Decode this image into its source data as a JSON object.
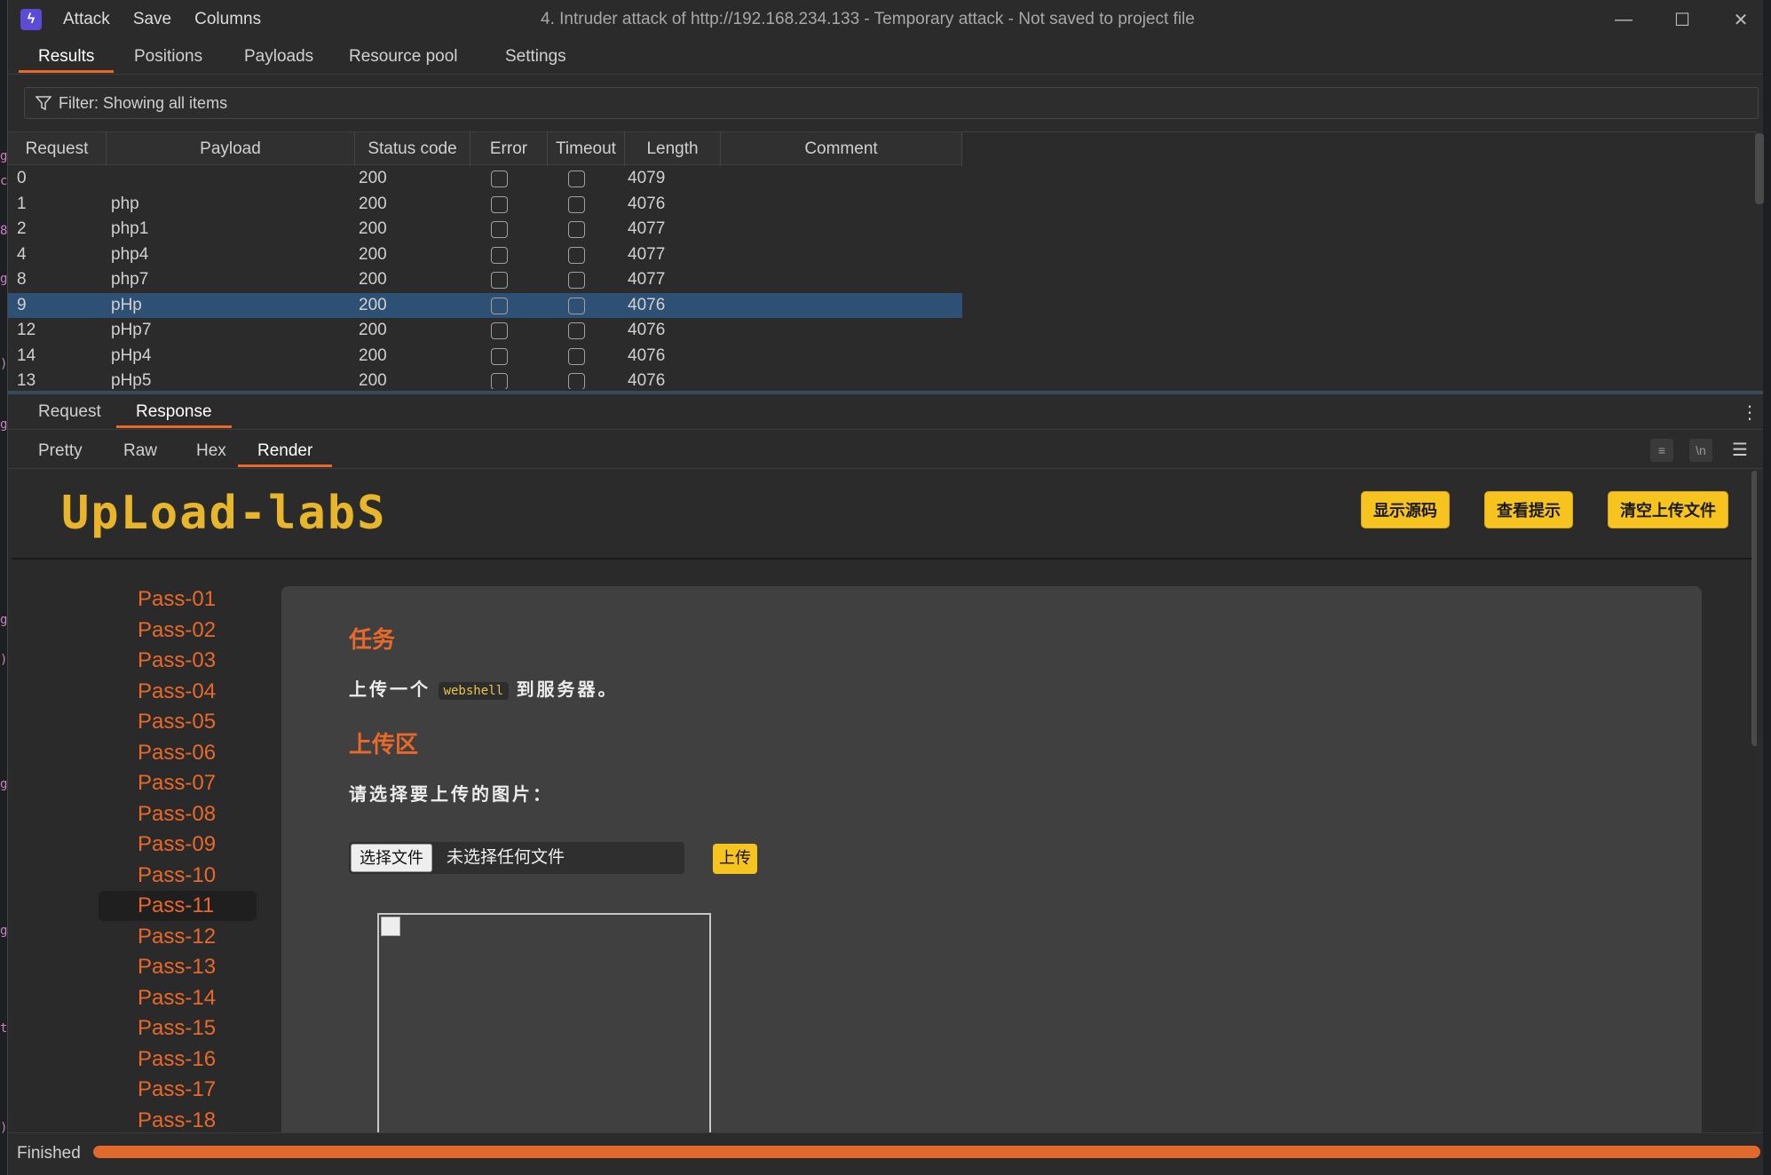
{
  "app": {
    "menu": [
      "Attack",
      "Save",
      "Columns"
    ],
    "title": "4. Intruder attack of http://192.168.234.133 - Temporary attack - Not saved to project file"
  },
  "tabs": [
    "Results",
    "Positions",
    "Payloads",
    "Resource pool",
    "Settings"
  ],
  "filter": {
    "text": "Filter: Showing all items"
  },
  "results": {
    "columns": [
      "Request",
      "Payload",
      "Status code",
      "Error",
      "Timeout",
      "Length",
      "Comment"
    ],
    "rows": [
      {
        "request": "0",
        "payload": "",
        "status": "200",
        "error": false,
        "timeout": false,
        "length": "4079"
      },
      {
        "request": "1",
        "payload": "php",
        "status": "200",
        "error": false,
        "timeout": false,
        "length": "4076"
      },
      {
        "request": "2",
        "payload": "php1",
        "status": "200",
        "error": false,
        "timeout": false,
        "length": "4077"
      },
      {
        "request": "4",
        "payload": "php4",
        "status": "200",
        "error": false,
        "timeout": false,
        "length": "4077"
      },
      {
        "request": "8",
        "payload": "php7",
        "status": "200",
        "error": false,
        "timeout": false,
        "length": "4077"
      },
      {
        "request": "9",
        "payload": "pHp",
        "status": "200",
        "error": false,
        "timeout": false,
        "length": "4076",
        "selected": true
      },
      {
        "request": "12",
        "payload": "pHp7",
        "status": "200",
        "error": false,
        "timeout": false,
        "length": "4076"
      },
      {
        "request": "14",
        "payload": "pHp4",
        "status": "200",
        "error": false,
        "timeout": false,
        "length": "4076"
      },
      {
        "request": "13",
        "payload": "pHp5",
        "status": "200",
        "error": false,
        "timeout": false,
        "length": "4076"
      }
    ]
  },
  "message_tabs": [
    "Request",
    "Response"
  ],
  "view_tabs": [
    "Pretty",
    "Raw",
    "Hex",
    "Render"
  ],
  "render": {
    "logo": "UpLoad-labS",
    "header_buttons": [
      "显示源码",
      "查看提示",
      "清空上传文件"
    ],
    "passes": [
      "Pass-01",
      "Pass-02",
      "Pass-03",
      "Pass-04",
      "Pass-05",
      "Pass-06",
      "Pass-07",
      "Pass-08",
      "Pass-09",
      "Pass-10",
      "Pass-11",
      "Pass-12",
      "Pass-13",
      "Pass-14",
      "Pass-15",
      "Pass-16",
      "Pass-17",
      "Pass-18"
    ],
    "current_pass": "Pass-11",
    "task_heading": "任务",
    "task_text_before": "上传一个",
    "task_code": "webshell",
    "task_text_after": "到服务器。",
    "upload_heading": "上传区",
    "upload_prompt": "请选择要上传的图片：",
    "choose_file": "选择文件",
    "no_file": "未选择任何文件",
    "upload_button": "上传"
  },
  "status": {
    "text": "Finished",
    "progress": 1.0
  },
  "colors": {
    "accent": "#e8692a",
    "selection": "#2e5074",
    "yellow": "#f6c31f"
  }
}
